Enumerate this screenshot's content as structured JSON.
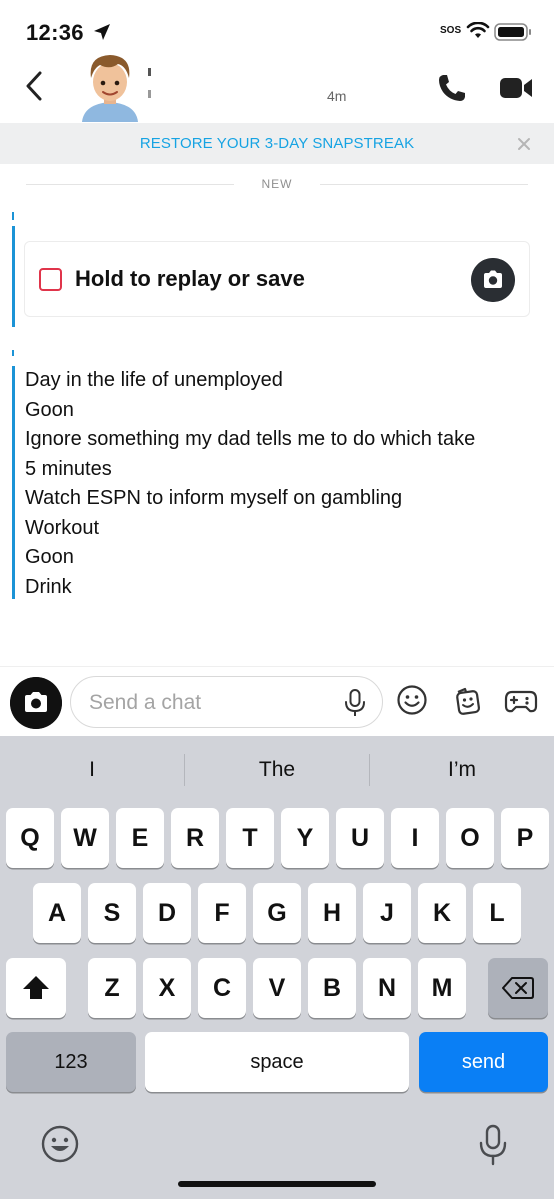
{
  "status_bar": {
    "time": "12:36",
    "sos": "SOS"
  },
  "header": {
    "last_seen": "4m"
  },
  "banner": {
    "text": "RESTORE YOUR 3-DAY SNAPSTREAK"
  },
  "chat": {
    "divider_label": "NEW",
    "snap_label": "Hold to replay or save",
    "message_lines": [
      "Day in the life of unemployed",
      "Goon",
      "Ignore something my dad tells me to do which take",
      "5 minutes",
      "Watch ESPN to inform myself on gambling",
      "Workout",
      "Goon",
      "Drink"
    ]
  },
  "input": {
    "placeholder": "Send a chat",
    "value": ""
  },
  "keyboard": {
    "suggestions": [
      "I",
      "The",
      "I’m"
    ],
    "row1": [
      "Q",
      "W",
      "E",
      "R",
      "T",
      "Y",
      "U",
      "I",
      "O",
      "P"
    ],
    "row2": [
      "A",
      "S",
      "D",
      "F",
      "G",
      "H",
      "J",
      "K",
      "L"
    ],
    "row3": [
      "Z",
      "X",
      "C",
      "V",
      "B",
      "N",
      "M"
    ],
    "numbers_label": "123",
    "space_label": "space",
    "send_label": "send"
  },
  "colors": {
    "accent_blue": "#1b93d6",
    "banner_text": "#16a3e3",
    "snap_red": "#e0344a",
    "send_key": "#0a7ff5"
  },
  "icons": [
    "location-arrow-icon",
    "wifi-icon",
    "battery-icon",
    "back-chevron-icon",
    "phone-icon",
    "video-icon",
    "close-icon",
    "camera-icon",
    "microphone-icon",
    "smiley-icon",
    "sticker-icon",
    "game-controller-icon",
    "shift-icon",
    "delete-icon",
    "emoji-icon"
  ]
}
